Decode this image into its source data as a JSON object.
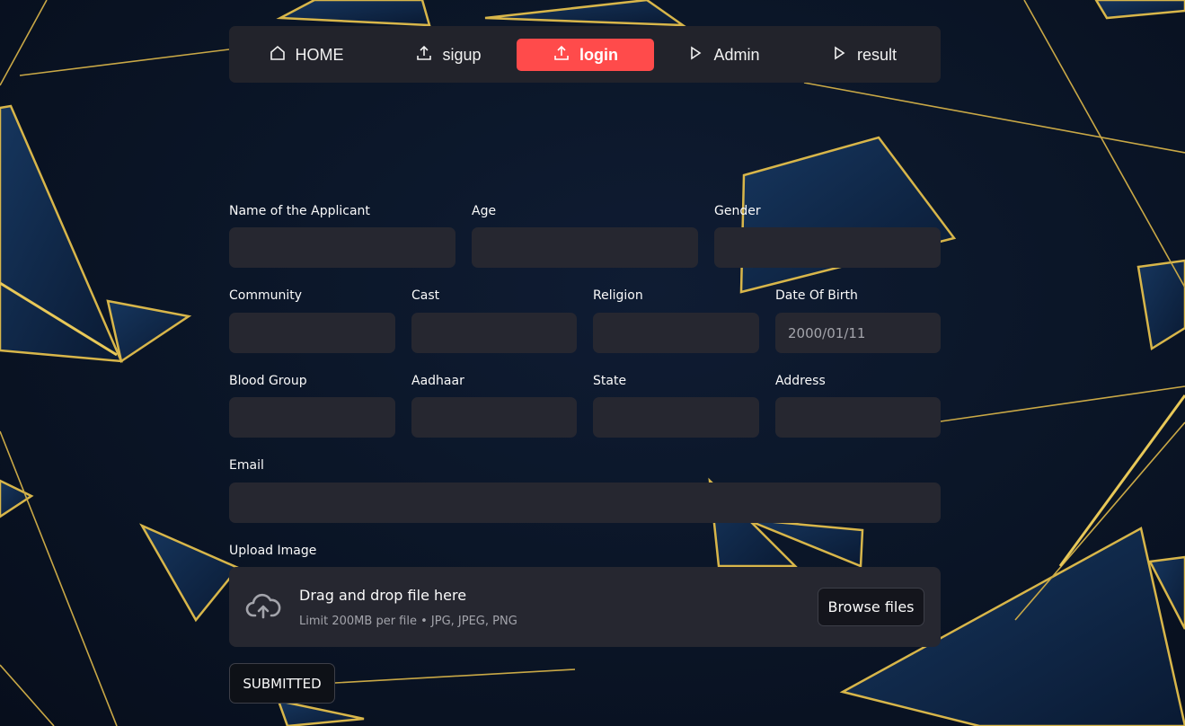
{
  "nav": {
    "items": [
      {
        "label": "HOME",
        "icon": "house-icon",
        "active": false
      },
      {
        "label": "sigup",
        "icon": "upload-icon",
        "active": false
      },
      {
        "label": "login",
        "icon": "upload-icon",
        "active": true
      },
      {
        "label": "Admin",
        "icon": "play-icon",
        "active": false
      },
      {
        "label": "result",
        "icon": "play-icon",
        "active": false
      }
    ]
  },
  "form": {
    "name_label": "Name of the Applicant",
    "age_label": "Age",
    "gender_label": "Gender",
    "community_label": "Community",
    "cast_label": "Cast",
    "religion_label": "Religion",
    "dob_label": "Date Of Birth",
    "dob_value": "2000/01/11",
    "blood_label": "Blood Group",
    "aadhaar_label": "Aadhaar",
    "state_label": "State",
    "address_label": "Address",
    "email_label": "Email",
    "upload_label": "Upload Image"
  },
  "uploader": {
    "main_text": "Drag and drop file here",
    "sub_text": "Limit 200MB per file • JPG, JPEG, PNG",
    "browse_label": "Browse files",
    "icon": "cloud-upload-icon"
  },
  "submit_label": "SUBMITTED",
  "colors": {
    "accent": "#ff4b4b",
    "nav_bg": "#22232b",
    "input_bg": "#262730",
    "background": "#0b1628",
    "gold": "#d8b64a"
  }
}
